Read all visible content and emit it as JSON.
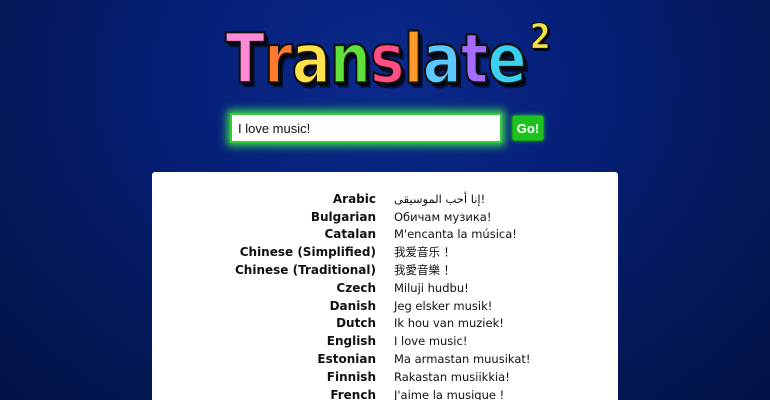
{
  "logo": {
    "letters": [
      {
        "char": "T",
        "color": "#ff8ad8"
      },
      {
        "char": "r",
        "color": "#ff7a2e"
      },
      {
        "char": "a",
        "color": "#ffe14a"
      },
      {
        "char": "n",
        "color": "#5fe03a"
      },
      {
        "char": "s",
        "color": "#ff4f86"
      },
      {
        "char": "l",
        "color": "#ff9a2a"
      },
      {
        "char": "a",
        "color": "#5cc8ff"
      },
      {
        "char": "t",
        "color": "#a66bff"
      },
      {
        "char": "e",
        "color": "#3ad0f0"
      }
    ],
    "superscript": "2"
  },
  "search": {
    "value": "I love music!",
    "go_label": "Go!"
  },
  "translations": [
    {
      "language": "Arabic",
      "text": "إنا أحب الموسيقى!"
    },
    {
      "language": "Bulgarian",
      "text": "Обичам музика!"
    },
    {
      "language": "Catalan",
      "text": "M'encanta la música!"
    },
    {
      "language": "Chinese (Simplified)",
      "text": "我爱音乐 ！"
    },
    {
      "language": "Chinese (Traditional)",
      "text": "我愛音樂 ！"
    },
    {
      "language": "Czech",
      "text": "Miluji hudbu!"
    },
    {
      "language": "Danish",
      "text": "Jeg elsker musik!"
    },
    {
      "language": "Dutch",
      "text": "Ik hou van muziek!"
    },
    {
      "language": "English",
      "text": "I love music!"
    },
    {
      "language": "Estonian",
      "text": "Ma armastan muusikat!"
    },
    {
      "language": "Finnish",
      "text": "Rakastan musiikkia!"
    },
    {
      "language": "French",
      "text": "J'aime la musique !"
    }
  ]
}
